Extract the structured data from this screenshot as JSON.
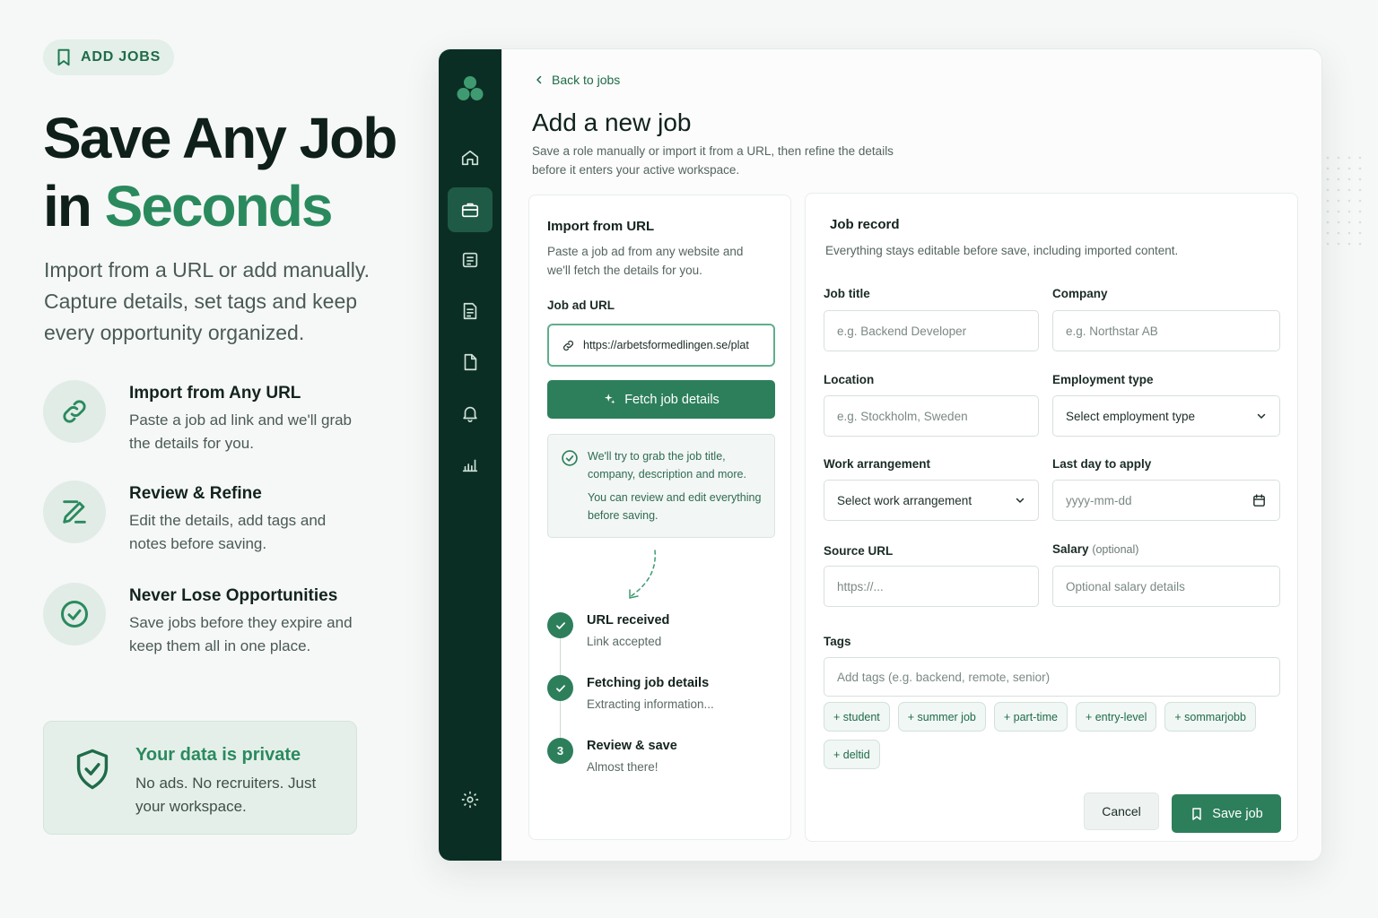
{
  "badge": {
    "label": "ADD JOBS",
    "icon": "bookmark-icon"
  },
  "hero": {
    "title_line1": "Save Any Job",
    "title_line2_prefix": "in",
    "title_line2_accent": "Seconds",
    "subtitle": "Import from a URL or add manually. Capture details, set tags and keep every opportunity organized."
  },
  "features": [
    {
      "icon": "link-icon",
      "title": "Import from Any URL",
      "desc": "Paste a job ad link and we'll grab the details for you."
    },
    {
      "icon": "edit-icon",
      "title": "Review & Refine",
      "desc": "Edit the details, add tags and notes before saving."
    },
    {
      "icon": "check-circle-icon",
      "title": "Never Lose Opportunities",
      "desc": "Save jobs before they expire and keep them all in one place."
    }
  ],
  "privacy": {
    "title": "Your data is private",
    "desc": "No ads. No recruiters. Just your workspace.",
    "icon": "shield-check-icon"
  },
  "sidebar": {
    "items": [
      {
        "name": "home",
        "icon": "home-icon",
        "active": false
      },
      {
        "name": "jobs",
        "icon": "briefcase-icon",
        "active": true
      },
      {
        "name": "list",
        "icon": "list-icon",
        "active": false
      },
      {
        "name": "notes",
        "icon": "document-icon",
        "active": false
      },
      {
        "name": "files",
        "icon": "file-icon",
        "active": false
      },
      {
        "name": "notifications",
        "icon": "bell-icon",
        "active": false
      },
      {
        "name": "analytics",
        "icon": "chart-icon",
        "active": false
      }
    ],
    "settings_icon": "gear-icon"
  },
  "page": {
    "back_label": "Back to jobs",
    "title": "Add a new job",
    "subtitle": "Save a role manually or import it from a URL, then refine the details before it enters your active workspace."
  },
  "import": {
    "title": "Import from URL",
    "desc": "Paste a job ad from any website and we'll fetch the details for you.",
    "url_label": "Job ad URL",
    "url_value": "https://arbetsformedlingen.se/plat",
    "fetch_label": "Fetch job details",
    "note_line1": "We'll try to grab the job title, company, description and more.",
    "note_line2": "You can review and edit everything before saving.",
    "steps": [
      {
        "title": "URL received",
        "desc": "Link accepted",
        "marker": ""
      },
      {
        "title": "Fetching job details",
        "desc": "Extracting information...",
        "marker": ""
      },
      {
        "title": "Review & save",
        "desc": "Almost there!",
        "marker": "3"
      }
    ]
  },
  "record": {
    "title": "Job record",
    "desc": "Everything stays editable before save, including imported content.",
    "job_title_label": "Job title",
    "job_title_placeholder": "e.g. Backend Developer",
    "company_label": "Company",
    "company_placeholder": "e.g. Northstar AB",
    "location_label": "Location",
    "location_placeholder": "e.g. Stockholm, Sweden",
    "employment_label": "Employment type",
    "employment_value": "Select employment type",
    "work_label": "Work arrangement",
    "work_value": "Select work arrangement",
    "lastday_label": "Last day to apply",
    "lastday_placeholder": "yyyy-mm-dd",
    "source_label": "Source URL",
    "source_placeholder": "https://...",
    "salary_label": "Salary",
    "salary_optional": "(optional)",
    "salary_placeholder": "Optional salary details",
    "tags_label": "Tags",
    "tags_placeholder": "Add tags (e.g. backend, remote, senior)",
    "suggested_tags": [
      "+ student",
      "+ summer job",
      "+ part-time",
      "+ entry-level",
      "+ sommarjobb",
      "+ deltid"
    ],
    "cancel_label": "Cancel",
    "save_label": "Save job"
  },
  "colors": {
    "accent": "#2a8a5e",
    "button": "#2d7f5b",
    "rail": "#0b2e24",
    "rail_active": "#1f5a46"
  }
}
